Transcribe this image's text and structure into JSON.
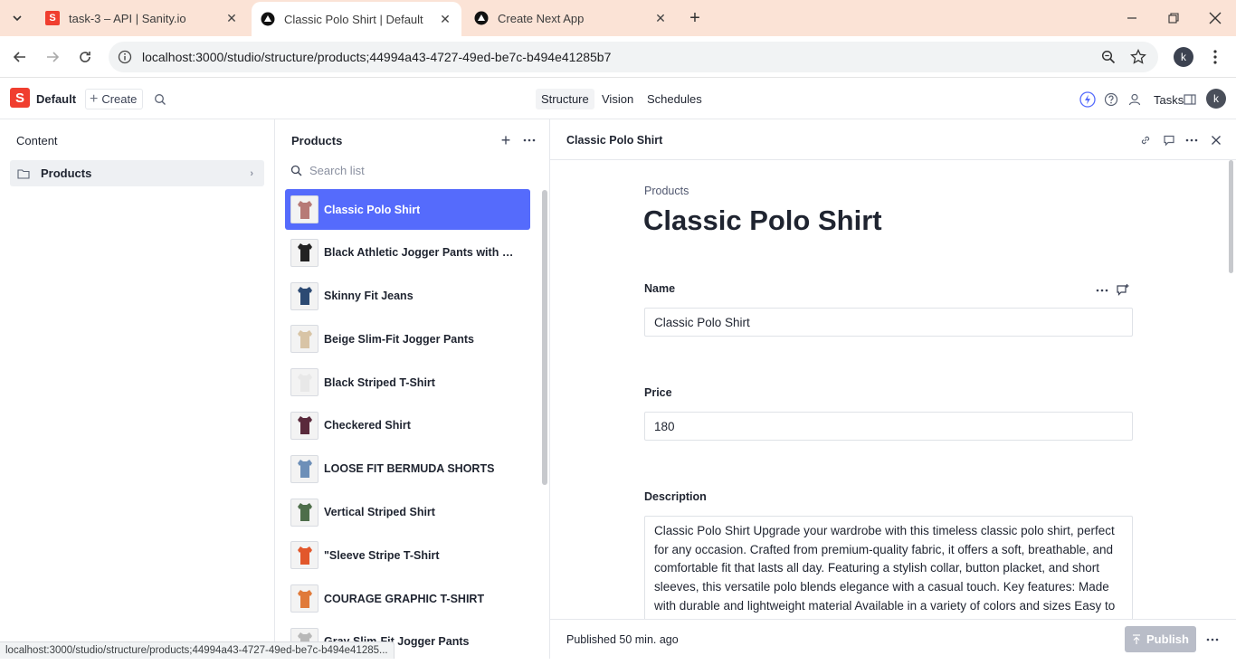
{
  "browser": {
    "tabs": [
      {
        "title": "task-3 – API | Sanity.io",
        "favicon": "sanity-icon",
        "active": false
      },
      {
        "title": "Classic Polo Shirt | Default",
        "favicon": "triangle-icon",
        "active": true
      },
      {
        "title": "Create Next App",
        "favicon": "triangle-icon",
        "active": false
      }
    ],
    "url": "localhost:3000/studio/structure/products;44994a43-4727-49ed-be7c-b494e41285b7",
    "profile_initial": "k",
    "status_url": "localhost:3000/studio/structure/products;44994a43-4727-49ed-be7c-b494e41285..."
  },
  "studio": {
    "logo_letter": "S",
    "workspace": "Default",
    "create_label": "Create",
    "tools": [
      "Structure",
      "Vision",
      "Schedules"
    ],
    "active_tool": "Structure",
    "tasks_label": "Tasks",
    "user_initial": "k"
  },
  "content_pane": {
    "title": "Content",
    "items": [
      {
        "label": "Products"
      }
    ]
  },
  "products_pane": {
    "title": "Products",
    "search_placeholder": "Search list",
    "items": [
      {
        "name": "Classic Polo Shirt",
        "thumb_color": "#b77a76",
        "selected": true
      },
      {
        "name": "Black Athletic Jogger Pants with Side...",
        "thumb_color": "#222222",
        "selected": false
      },
      {
        "name": "Skinny Fit Jeans",
        "thumb_color": "#2d4a73",
        "selected": false
      },
      {
        "name": "Beige Slim-Fit Jogger Pants",
        "thumb_color": "#d8c4a6",
        "selected": false
      },
      {
        "name": "Black Striped T-Shirt",
        "thumb_color": "#e8e8e8",
        "selected": false
      },
      {
        "name": "Checkered Shirt",
        "thumb_color": "#5a2a3c",
        "selected": false
      },
      {
        "name": "LOOSE FIT BERMUDA SHORTS",
        "thumb_color": "#6d8fb8",
        "selected": false
      },
      {
        "name": "Vertical Striped Shirt",
        "thumb_color": "#4e6e4a",
        "selected": false
      },
      {
        "name": "\"Sleeve Stripe T-Shirt",
        "thumb_color": "#e2572b",
        "selected": false
      },
      {
        "name": "COURAGE GRAPHIC T-SHIRT",
        "thumb_color": "#e07a3a",
        "selected": false
      },
      {
        "name": "Gray Slim-Fit Jogger Pants",
        "thumb_color": "#b8b8b8",
        "selected": false
      }
    ]
  },
  "document": {
    "header_title": "Classic Polo Shirt",
    "breadcrumb": "Products",
    "title": "Classic Polo Shirt",
    "fields": {
      "name": {
        "label": "Name",
        "value": "Classic Polo Shirt"
      },
      "price": {
        "label": "Price",
        "value": "180"
      },
      "description": {
        "label": "Description",
        "value": "Classic Polo Shirt Upgrade your wardrobe with this timeless classic polo shirt, perfect for any occasion. Crafted from premium-quality fabric, it offers a soft, breathable, and comfortable fit that lasts all day. Featuring a stylish collar, button placket, and short sleeves, this versatile polo blends elegance with a casual touch. Key features: Made with durable and lightweight material Available in a variety of colors and sizes Easy to"
      }
    },
    "status": "Published 50 min. ago",
    "publish_label": "Publish"
  },
  "colors": {
    "accent": "#556bfc",
    "sanity_red": "#f03e2f",
    "tab_strip": "#fbe3d6"
  }
}
